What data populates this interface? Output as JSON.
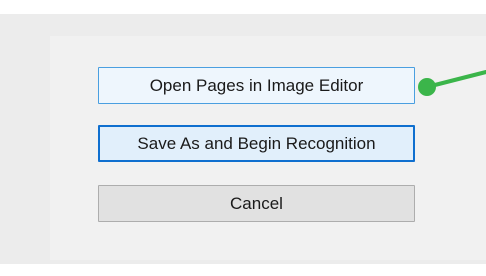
{
  "dialog": {
    "buttons": {
      "open_pages_label": "Open Pages in Image Editor",
      "save_as_label": "Save As and Begin Recognition",
      "cancel_label": "Cancel"
    }
  },
  "annotation": {
    "pointer_color": "#3bb54a"
  }
}
